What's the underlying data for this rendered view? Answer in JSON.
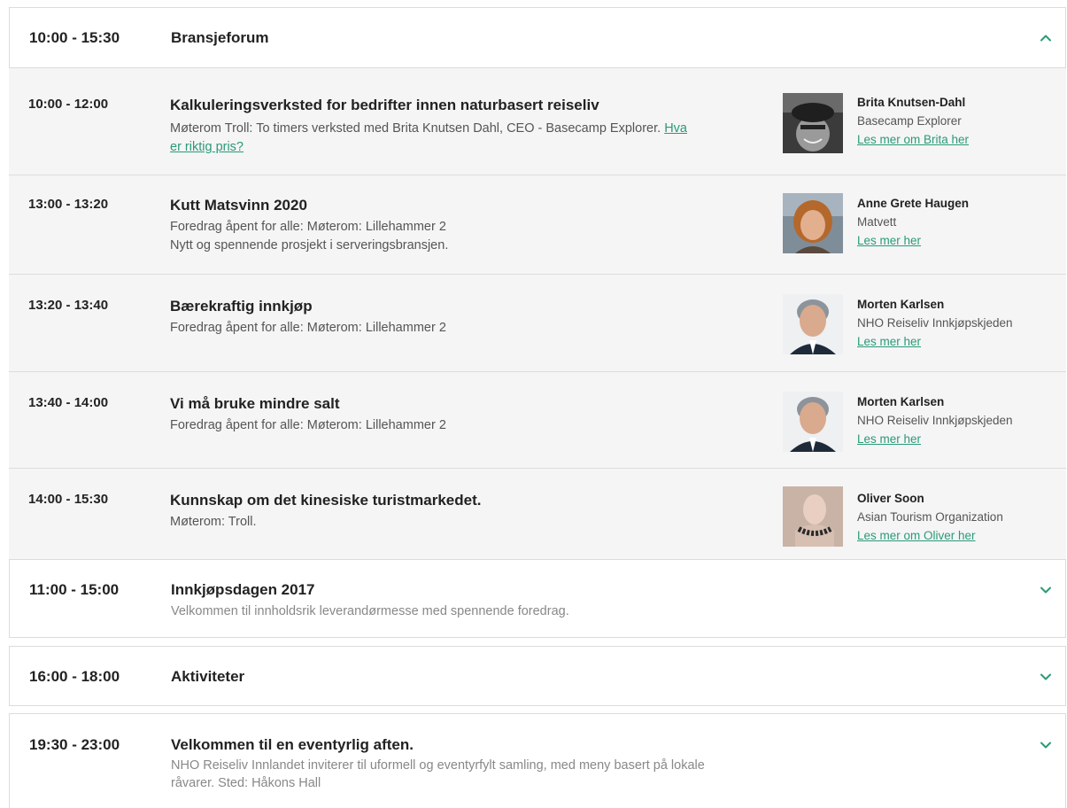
{
  "top_section": {
    "time": "10:00 - 15:30",
    "title": "Bransjeforum",
    "toggle_icon": "chevron-up-icon"
  },
  "sessions": [
    {
      "time": "10:00 - 12:00",
      "title": "Kalkuleringsverksted for bedrifter innen naturbasert reiseliv",
      "desc": "Møterom Troll: To timers verksted med Brita Knutsen Dahl, CEO - Basecamp Explorer.",
      "desc_link": "Hva er riktig pris?",
      "speaker_name": "Brita Knutsen-Dahl",
      "speaker_org": "Basecamp Explorer",
      "speaker_link": "Les mer om Brita her"
    },
    {
      "time": "13:00 - 13:20",
      "title": "Kutt Matsvinn 2020",
      "desc": "Foredrag åpent for alle: Møterom: Lillehammer 2",
      "desc2": "Nytt og spennende prosjekt i serveringsbransjen.",
      "speaker_name": "Anne Grete Haugen",
      "speaker_org": "Matvett",
      "speaker_link": "Les mer her"
    },
    {
      "time": "13:20 - 13:40",
      "title": "Bærekraftig innkjøp",
      "desc": "Foredrag åpent for alle: Møterom: Lillehammer 2",
      "speaker_name": "Morten Karlsen",
      "speaker_org": "NHO Reiseliv Innkjøpskjeden",
      "speaker_link": "Les mer her"
    },
    {
      "time": "13:40 - 14:00",
      "title": "Vi må bruke mindre salt",
      "desc": "Foredrag åpent for alle: Møterom: Lillehammer 2",
      "speaker_name": "Morten Karlsen",
      "speaker_org": "NHO Reiseliv Innkjøpskjeden",
      "speaker_link": "Les mer her"
    },
    {
      "time": "14:00 - 15:30",
      "title": "Kunnskap om det kinesiske turistmarkedet.",
      "desc": "Møterom: Troll.",
      "speaker_name": "Oliver Soon",
      "speaker_org": "Asian Tourism Organization",
      "speaker_link": "Les mer om Oliver her"
    }
  ],
  "sections": [
    {
      "time": "11:00 - 15:00",
      "title": "Innkjøpsdagen 2017",
      "desc": "Velkommen til innholdsrik leverandørmesse med spennende foredrag.",
      "toggle_icon": "chevron-down-icon"
    },
    {
      "time": "16:00 - 18:00",
      "title": "Aktiviteter",
      "toggle_icon": "chevron-down-icon"
    },
    {
      "time": "19:30 - 23:00",
      "title": "Velkommen til en eventyrlig aften.",
      "desc": "NHO Reiseliv Innlandet inviterer til uformell og eventyrfylt samling, med meny basert på lokale råvarer. Sted: Håkons Hall",
      "toggle_icon": "chevron-down-icon"
    }
  ],
  "colors": {
    "accent": "#2a9a78",
    "session_bg": "#f5f5f5",
    "border": "#dcdcdc"
  }
}
